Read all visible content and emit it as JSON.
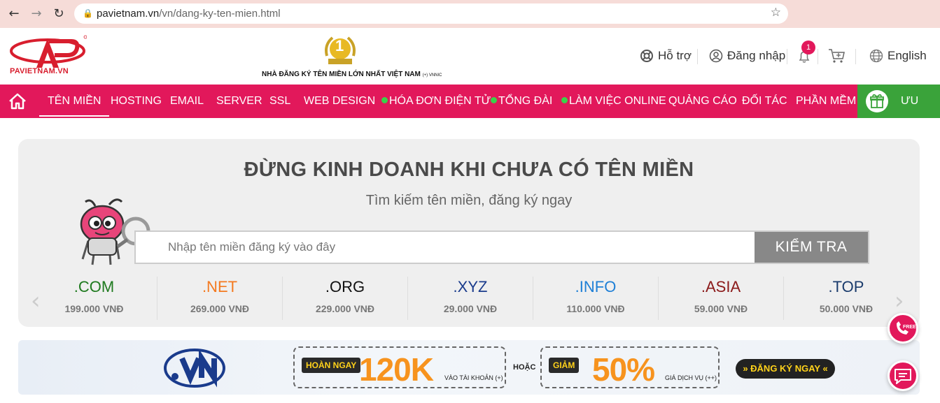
{
  "browser": {
    "url_host": "pavietnam.vn",
    "url_path": "/vn/dang-ky-ten-mien.html"
  },
  "header": {
    "logo_text": "PAVIETNAM.VN",
    "badge_number": "1",
    "tagline": "NHÀ ĐĂNG KÝ TÊN MIỀN LỚN NHẤT VIỆT NAM",
    "tagline_suffix": "(+) VNNIC",
    "support_label": "Hỗ trợ",
    "login_label": "Đăng nhập",
    "notification_count": "1",
    "language_label": "English"
  },
  "nav": {
    "items": [
      {
        "label": "TÊN MIỀN"
      },
      {
        "label": "HOSTING"
      },
      {
        "label": "EMAIL"
      },
      {
        "label": "SERVER"
      },
      {
        "label": "SSL"
      },
      {
        "label": "WEB DESIGN"
      },
      {
        "label": "HÓA ĐƠN ĐIỆN TỬ"
      },
      {
        "label": "TỔNG ĐÀI"
      },
      {
        "label": "LÀM VIỆC ONLINE"
      },
      {
        "label": "QUẢNG CÁO"
      },
      {
        "label": "ĐỐI TÁC"
      },
      {
        "label": "PHẦN MỀM"
      }
    ],
    "promo_label": "ƯU ĐÃI"
  },
  "search": {
    "title": "ĐỪNG KINH DOANH KHI CHƯA CÓ TÊN MIỀN",
    "subtitle": "Tìm kiếm tên miền, đăng ký ngay",
    "placeholder": "Nhập tên miền đăng ký vào đây",
    "button_label": "KIỂM TRA"
  },
  "tlds": [
    {
      "name": ".COM",
      "price": "199.000 VNĐ",
      "color": "#1f7a1f"
    },
    {
      "name": ".NET",
      "price": "269.000 VNĐ",
      "color": "#f47a20"
    },
    {
      "name": ".ORG",
      "price": "229.000 VNĐ",
      "color": "#111111"
    },
    {
      "name": ".XYZ",
      "price": "29.000 VNĐ",
      "color": "#1a3b8c"
    },
    {
      "name": ".INFO",
      "price": "110.000 VNĐ",
      "color": "#1e7fd6"
    },
    {
      "name": ".ASIA",
      "price": "59.000 VNĐ",
      "color": "#8b1a1a"
    },
    {
      "name": ".TOP",
      "price": "50.000 VNĐ",
      "color": "#1a3b6c"
    }
  ],
  "banner": {
    "pill1": "HOÀN NGAY",
    "amount1": "120K",
    "note1": "VÀO TÀI KHOẢN (+)",
    "or_text": "HOẶC",
    "pill2": "GIẢM",
    "amount2": "50%",
    "note2": "GIÁ DỊCH VỤ (++)",
    "cta_label": "» ĐĂNG KÝ NGAY «"
  },
  "float": {
    "free_label": "FREE"
  }
}
